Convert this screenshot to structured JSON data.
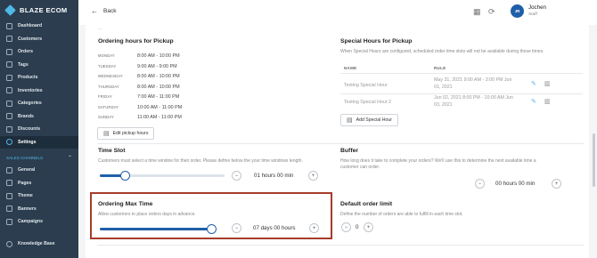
{
  "brand": "BLAZE ECOM",
  "nav": [
    {
      "label": "Dashboard"
    },
    {
      "label": "Customers"
    },
    {
      "label": "Orders"
    },
    {
      "label": "Tags"
    },
    {
      "label": "Products"
    },
    {
      "label": "Inventories"
    },
    {
      "label": "Categories"
    },
    {
      "label": "Brands"
    },
    {
      "label": "Discounts"
    },
    {
      "label": "Settings"
    }
  ],
  "sales_channels": {
    "label": "SALES CHANNELS",
    "items": [
      {
        "label": "General"
      },
      {
        "label": "Pages"
      },
      {
        "label": "Theme"
      },
      {
        "label": "Banners"
      },
      {
        "label": "Campaigns"
      }
    ]
  },
  "knowledge_base": "Knowledge Base",
  "header": {
    "back": "Back",
    "user_name": "Jochen",
    "user_role": "Staff",
    "avatar_initials": "JR"
  },
  "clipped_text": "...",
  "pickup": {
    "title": "Ordering hours for Pickup",
    "rows": [
      {
        "day": "MONDAY",
        "time": "8:00 AM - 10:00 PM"
      },
      {
        "day": "TUESDAY",
        "time": "9:00 AM - 9:00 PM"
      },
      {
        "day": "WEDNESDAY",
        "time": "8:00 AM - 10:00 PM"
      },
      {
        "day": "THURSDAY",
        "time": "8:00 AM - 10:00 PM"
      },
      {
        "day": "FRIDAY",
        "time": "7:00 AM - 11:00 PM"
      },
      {
        "day": "SATURDAY",
        "time": "10:00 AM - 11:00 PM"
      },
      {
        "day": "SUNDAY",
        "time": "11:00 AM - 11:00 PM"
      }
    ],
    "edit_button": "Edit pickup hours"
  },
  "special": {
    "title": "Special Hours for Pickup",
    "desc": "When Special Hours are configured, scheduled order time slots will not be available during those times.",
    "col_name": "NAME",
    "col_rule": "RULE",
    "rows": [
      {
        "name": "Testing Special Hour",
        "rule_line1": "May 31, 2021 9:00 AM - 3:00 PM Jun",
        "rule_line2": "01, 2021"
      },
      {
        "name": "Testing Special Hour 2",
        "rule_line1": "Jun 02, 2021 8:00 PM - 10:00 AM Jun",
        "rule_line2": "03, 2021"
      }
    ],
    "add_button": "Add Special Hour"
  },
  "time_slot": {
    "title": "Time Slot",
    "desc": "Customers must select a time window for their order. Please define below the your time windows length.",
    "value": "01 hours 00 min",
    "slider_fraction": 0.2
  },
  "buffer": {
    "title": "Buffer",
    "desc_line1": "How long does it take to complete your orders? We'll use this to determine the next available time a",
    "desc_line2": "customer can order.",
    "value": "00 hours 00 min"
  },
  "max_time": {
    "title": "Ordering Max Time",
    "desc": "Allow customers to place orders days in advance.",
    "value": "07 days 00 hours",
    "slider_fraction": 0.98
  },
  "order_limit": {
    "title": "Default order limit",
    "desc": "Define the number of orders are able to fulfill in each time slot.",
    "value": "0"
  },
  "steppers": {
    "minus": "−",
    "plus": "+"
  },
  "icons": {
    "edit": "✎",
    "trash": "🗑",
    "calendar": "📅",
    "back_arrow": "←"
  },
  "colors": {
    "sidebar": "#2b3d4f",
    "accent": "#4fb8e6",
    "slider": "#1f5fa8",
    "highlight": "#a63c2a"
  }
}
